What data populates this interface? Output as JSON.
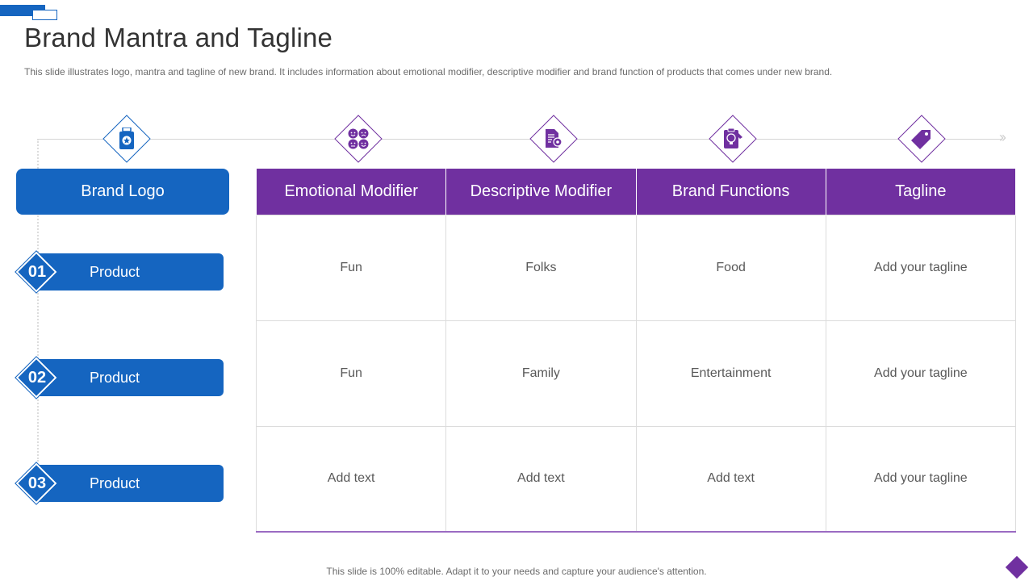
{
  "title": "Brand Mantra and Tagline",
  "subtitle": "This slide illustrates logo, mantra and tagline of new brand. It includes information  about emotional modifier, descriptive modifier and brand function of products that comes under new brand.",
  "brand_logo_label": "Brand Logo",
  "products": [
    {
      "number": "01",
      "label": "Product"
    },
    {
      "number": "02",
      "label": "Product"
    },
    {
      "number": "03",
      "label": "Product"
    }
  ],
  "table": {
    "headers": [
      "Emotional Modifier",
      "Descriptive Modifier",
      "Brand Functions",
      "Tagline"
    ],
    "rows": [
      [
        "Fun",
        "Folks",
        "Food",
        "Add your tagline"
      ],
      [
        "Fun",
        "Family",
        "Entertainment",
        "Add your tagline"
      ],
      [
        "Add text",
        "Add text",
        "Add text",
        "Add your tagline"
      ]
    ]
  },
  "icons": [
    "id-badge-icon",
    "emotions-icon",
    "document-settings-icon",
    "lightbulb-clipboard-icon",
    "price-tag-icon"
  ],
  "footer": "This slide is 100% editable. Adapt it to your needs and capture your audience's attention.",
  "colors": {
    "blue": "#1565c0",
    "purple": "#7030a0"
  }
}
